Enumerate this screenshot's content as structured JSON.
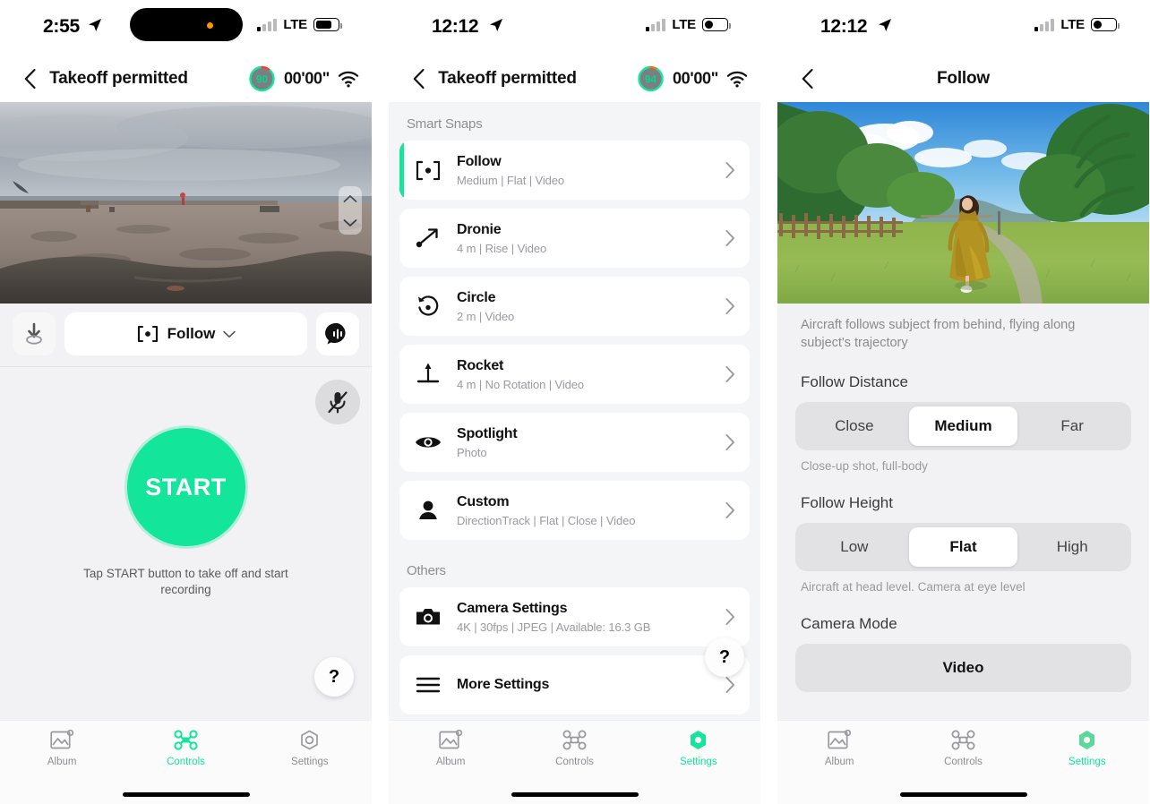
{
  "theme": {
    "accent_green": "#13e59a",
    "bg_grey": "#f2f2f4",
    "list_bg": "#f4f5f7",
    "text_primary": "#111111",
    "text_secondary": "#8e8e93"
  },
  "panel1": {
    "status_bar": {
      "time": "2:55",
      "carrier": "LTE",
      "location_icon": "location-arrow-icon"
    },
    "nav": {
      "back_icon": "chevron-left-icon",
      "title": "Takeoff permitted",
      "battery_percent": "90",
      "flight_timer": "00'00\"",
      "wifi_icon": "wifi-icon"
    },
    "preview": {
      "scene": "overcast-beach-live-feed",
      "altitude_up_icon": "chevron-up-icon",
      "altitude_down_icon": "chevron-down-icon"
    },
    "mode_bar": {
      "download_icon": "download-icon",
      "mode_icon": "follow-target-icon",
      "mode_label": "Follow",
      "mode_dropdown_icon": "chevron-down-icon",
      "voice_icon": "voice-command-icon"
    },
    "controls": {
      "mic_icon": "mic-muted-icon",
      "start_label": "START",
      "hint": "Tap START button to take off and start recording",
      "help_label": "?"
    },
    "tabs": [
      {
        "label": "Album",
        "icon": "album-icon",
        "selected": false
      },
      {
        "label": "Controls",
        "icon": "drone-icon",
        "selected": true
      },
      {
        "label": "Settings",
        "icon": "hex-settings-icon",
        "selected": false
      }
    ]
  },
  "panel2": {
    "status_bar": {
      "time": "12:12",
      "carrier": "LTE",
      "location_icon": "location-arrow-icon"
    },
    "nav": {
      "back_icon": "chevron-left-icon",
      "title": "Takeoff permitted",
      "battery_percent": "94",
      "flight_timer": "00'00\"",
      "wifi_icon": "wifi-icon"
    },
    "sections": [
      {
        "header": "Smart Snaps",
        "items": [
          {
            "title": "Follow",
            "subtitle": "Medium | Flat | Video",
            "icon": "follow-target-icon",
            "active": true
          },
          {
            "title": "Dronie",
            "subtitle": "4 m | Rise | Video",
            "icon": "dronie-arrow-icon",
            "active": false
          },
          {
            "title": "Circle",
            "subtitle": "2 m | Video",
            "icon": "circle-orbit-icon",
            "active": false
          },
          {
            "title": "Rocket",
            "subtitle": "4 m | No Rotation | Video",
            "icon": "rocket-up-icon",
            "active": false
          },
          {
            "title": "Spotlight",
            "subtitle": "Photo",
            "icon": "eye-icon",
            "active": false
          },
          {
            "title": "Custom",
            "subtitle": "DirectionTrack | Flat | Close | Video",
            "icon": "person-icon",
            "active": false
          }
        ]
      },
      {
        "header": "Others",
        "items": [
          {
            "title": "Camera Settings",
            "subtitle": "4K | 30fps | JPEG | Available: 16.3 GB",
            "icon": "camera-icon",
            "active": false
          },
          {
            "title": "More Settings",
            "subtitle": "",
            "icon": "hamburger-icon",
            "active": false
          }
        ]
      }
    ],
    "help_label": "?",
    "tabs": [
      {
        "label": "Album",
        "icon": "album-icon",
        "selected": false
      },
      {
        "label": "Controls",
        "icon": "drone-icon",
        "selected": false
      },
      {
        "label": "Settings",
        "icon": "hex-settings-icon",
        "selected": true
      }
    ]
  },
  "panel3": {
    "status_bar": {
      "time": "12:12",
      "carrier": "LTE",
      "location_icon": "location-arrow-icon"
    },
    "nav": {
      "back_icon": "chevron-left-icon",
      "title": "Follow"
    },
    "preview": {
      "scene": "woman-in-yellow-dress-on-grass-path"
    },
    "description": "Aircraft follows subject from behind, flying along subject's trajectory",
    "groups": [
      {
        "label": "Follow Distance",
        "options": [
          "Close",
          "Medium",
          "Far"
        ],
        "selected": "Medium",
        "note": "Close-up shot, full-body"
      },
      {
        "label": "Follow Height",
        "options": [
          "Low",
          "Flat",
          "High"
        ],
        "selected": "Flat",
        "note": "Aircraft at head level. Camera at eye level"
      },
      {
        "label": "Camera Mode",
        "options": [
          "Video"
        ],
        "selected": "Video",
        "note": ""
      }
    ],
    "tabs": [
      {
        "label": "Album",
        "icon": "album-icon",
        "selected": false
      },
      {
        "label": "Controls",
        "icon": "drone-icon",
        "selected": false
      },
      {
        "label": "Settings",
        "icon": "hex-settings-icon",
        "selected": true
      }
    ]
  }
}
